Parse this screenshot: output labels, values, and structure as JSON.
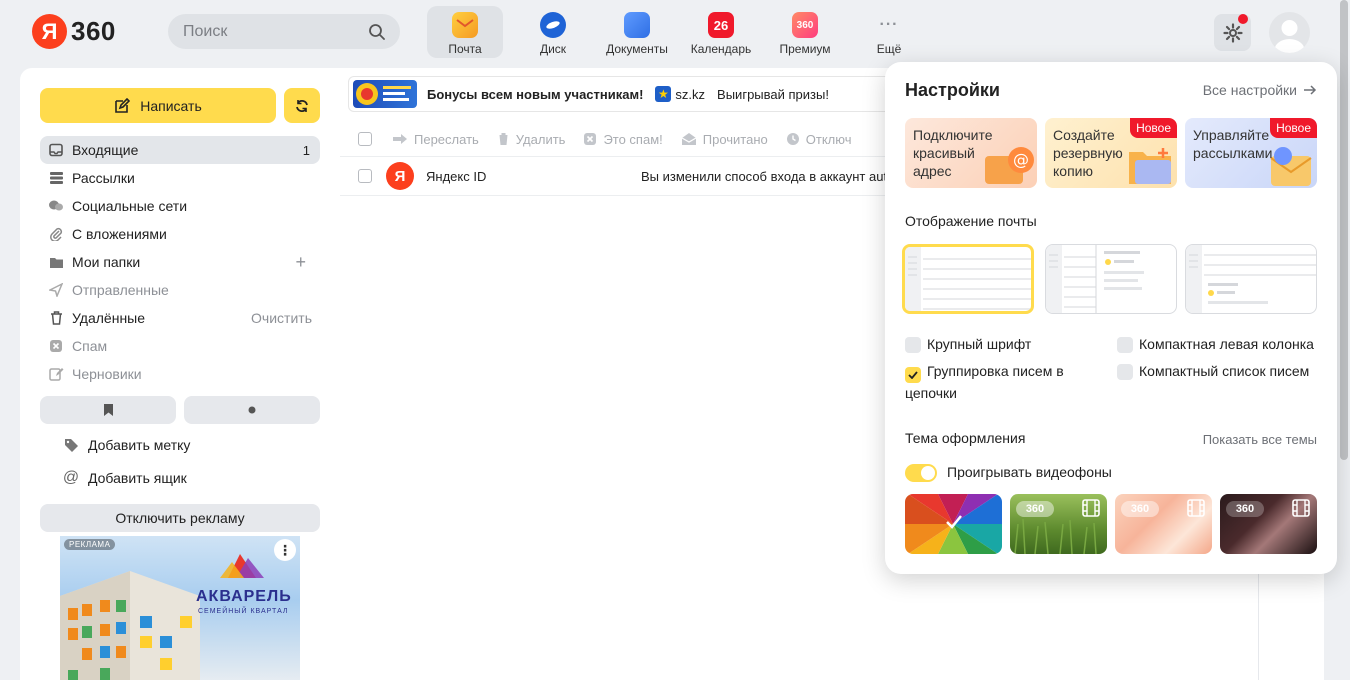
{
  "header": {
    "logo_letter": "Я",
    "logo_text": "360",
    "search_placeholder": "Поиск",
    "services": [
      {
        "label": "Почта",
        "icon": "mail-icon",
        "active": true,
        "color": "#f5a623"
      },
      {
        "label": "Диск",
        "icon": "disk-icon",
        "active": false,
        "color": "#1e63d6"
      },
      {
        "label": "Документы",
        "icon": "documents-icon",
        "active": false,
        "color": "#2f6fe4"
      },
      {
        "label": "Календарь",
        "icon": "calendar-icon",
        "active": false,
        "color": "#f0192b",
        "badge": "26"
      },
      {
        "label": "Премиум",
        "icon": "premium-icon",
        "active": false,
        "color": "#ff5a5a",
        "badge": "360"
      },
      {
        "label": "Ещё",
        "icon": "more-icon",
        "active": false,
        "color": "#8d9096"
      }
    ]
  },
  "sidebar": {
    "compose_label": "Написать",
    "folders": [
      {
        "label": "Входящие",
        "icon": "inbox-icon",
        "count": "1",
        "selected": true,
        "dim": false
      },
      {
        "label": "Рассылки",
        "icon": "newsletters-icon",
        "selected": false,
        "dim": false
      },
      {
        "label": "Социальные сети",
        "icon": "social-icon",
        "selected": false,
        "dim": false
      },
      {
        "label": "С вложениями",
        "icon": "attachment-icon",
        "selected": false,
        "dim": false
      },
      {
        "label": "Мои папки",
        "icon": "folder-icon",
        "action": "+",
        "selected": false,
        "dim": false
      },
      {
        "label": "Отправленные",
        "icon": "sent-icon",
        "selected": false,
        "dim": true
      },
      {
        "label": "Удалённые",
        "icon": "trash-icon",
        "action": "Очистить",
        "selected": false,
        "dim": false
      },
      {
        "label": "Спам",
        "icon": "spam-icon",
        "selected": false,
        "dim": true
      },
      {
        "label": "Черновики",
        "icon": "drafts-icon",
        "selected": false,
        "dim": true
      }
    ],
    "add_label": "Добавить метку",
    "add_mailbox": "Добавить ящик",
    "disable_ads": "Отключить рекламу",
    "ad": {
      "label": "РЕКЛАМА",
      "title": "АКВАРЕЛЬ",
      "subtitle": "СЕМЕЙНЫЙ КВАРТАЛ"
    }
  },
  "main": {
    "promo": {
      "text1": "Бонусы всем новым участникам!",
      "sponsor": "sz.kz",
      "text2": "Выигрывай призы!"
    },
    "toolbar": [
      "Переслать",
      "Удалить",
      "Это спам!",
      "Прочитано",
      "Отключ"
    ],
    "messages": [
      {
        "sender": "Яндекс ID",
        "subject": "Вы изменили способ входа в аккаунт aut"
      }
    ]
  },
  "settings": {
    "title": "Настройки",
    "all_settings": "Все настройки",
    "promo_cards": [
      {
        "text": "Подключите красивый адрес",
        "badge": "",
        "bg": "#fde3d5"
      },
      {
        "text": "Создайте резервную копию",
        "badge": "Новое",
        "bg": "#fdecc9"
      },
      {
        "text": "Управляйте рассылками",
        "badge": "Новое",
        "bg": "#dfe6fb"
      }
    ],
    "display_title": "Отображение почты",
    "options": [
      {
        "label": "Крупный шрифт",
        "checked": false
      },
      {
        "label": "Компактная левая колонка",
        "checked": false
      },
      {
        "label": "Группировка писем в цепочки",
        "checked": true
      },
      {
        "label": "Компактный список писем",
        "checked": false
      }
    ],
    "theme_title": "Тема оформления",
    "show_all_themes": "Показать все темы",
    "video_bg_label": "Проигрывать видеофоны",
    "theme_logo": "360"
  }
}
